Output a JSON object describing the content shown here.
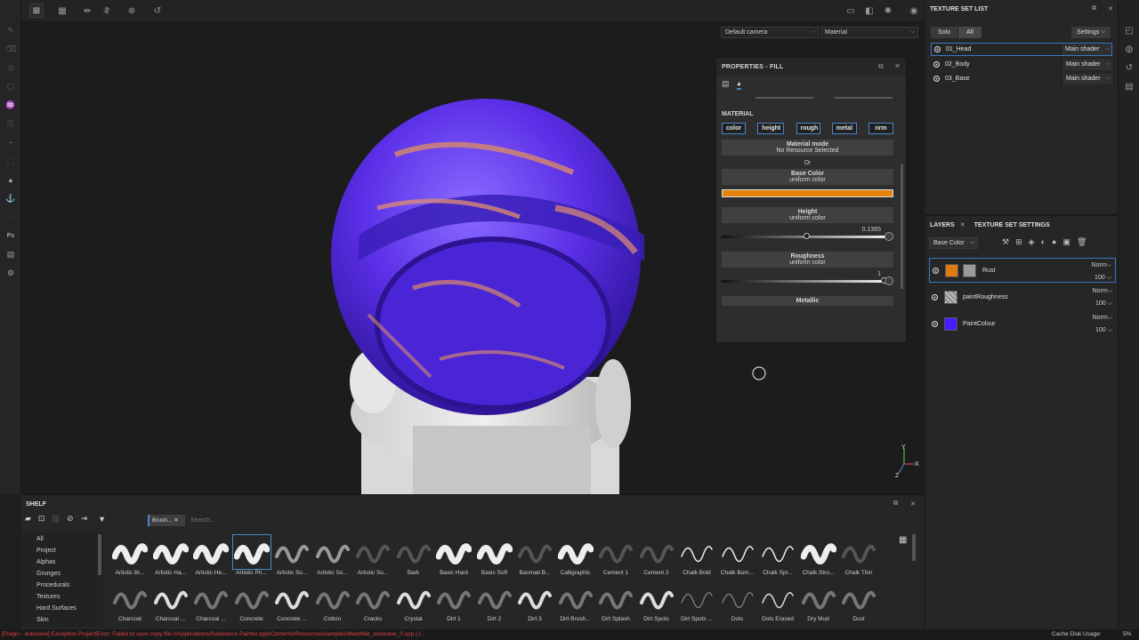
{
  "viewport": {
    "camera": "Default camera",
    "mode": "Material",
    "axis": {
      "y": "Y",
      "x": "X",
      "z": "Z"
    }
  },
  "properties": {
    "title": "PROPERTIES - FILL",
    "section": "MATERIAL",
    "chips": [
      "color",
      "height",
      "rough",
      "metal",
      "nrm"
    ],
    "material_mode": {
      "label": "Material mode",
      "value": "No Resource Selected"
    },
    "or_label": "Or",
    "base_color": {
      "label": "Base Color",
      "mode": "uniform color",
      "swatch": "#e6820e"
    },
    "height": {
      "label": "Height",
      "mode": "uniform color",
      "value": "0.1365",
      "fraction": 0.52
    },
    "roughness": {
      "label": "Roughness",
      "mode": "uniform color",
      "value": "1",
      "fraction": 1.0
    },
    "metallic": {
      "label": "Metallic"
    }
  },
  "texture_set_list": {
    "title": "TEXTURE SET LIST",
    "solo": "Solo",
    "all": "All",
    "settings": "Settings",
    "sets": [
      {
        "name": "01_Head",
        "shader": "Main shader"
      },
      {
        "name": "02_Body",
        "shader": "Main shader"
      },
      {
        "name": "03_Base",
        "shader": "Main shader"
      }
    ]
  },
  "layers_panel": {
    "tab_layers": "LAYERS",
    "tab_settings": "TEXTURE SET SETTINGS",
    "channel": "Base Color",
    "layers": [
      {
        "name": "Rust",
        "blend": "Norm",
        "opacity": "100",
        "color": "#e07a12"
      },
      {
        "name": "paintRoughness",
        "blend": "Norm",
        "opacity": "100",
        "color": "#bdbdbd"
      },
      {
        "name": "PaintColour",
        "blend": "Norm",
        "opacity": "100",
        "color": "#4a1cff"
      }
    ]
  },
  "shelf": {
    "title": "SHELF",
    "filter_tag": "Brush...",
    "search_placeholder": "Search...",
    "categories": [
      "All",
      "Project",
      "Alphas",
      "Grunges",
      "Procedurals",
      "Textures",
      "Hard Surfaces",
      "Skin"
    ],
    "row1": [
      "Artistic Br...",
      "Artistic Ha...",
      "Artistic He...",
      "Artistic Pri...",
      "Artistic So...",
      "Artistic So...",
      "Artistic So...",
      "Bark",
      "Basic Hard",
      "Basic Soft",
      "Basmati B...",
      "Calligraphic",
      "Cement 1",
      "Cement 2",
      "Chalk Bold",
      "Chalk Bum...",
      "Chalk Spr...",
      "Chalk Stro...",
      "Chalk Thin"
    ],
    "row2": [
      "Charcoal",
      "Charcoal ...",
      "Charcoal ...",
      "Concrete",
      "Concrete ...",
      "Cotton",
      "Cracks",
      "Crystal",
      "Dirt 1",
      "Dirt 2",
      "Dirt 3",
      "Dirt Brush...",
      "Dirt Splash",
      "Dirt Spots",
      "Dirt Spots ...",
      "Dots",
      "Dots Erased",
      "Dry Mud",
      "Dust"
    ]
  },
  "status": {
    "error": "[Plugin - autosave] Exception ProjectError: Failed to save copy file:///Applications/Substance Painter.app/Contents/Resources/samples/MeetMat_autosave_0.spp (:/...",
    "cache_label": "Cache Disk Usage:",
    "cache_value": "5%"
  }
}
